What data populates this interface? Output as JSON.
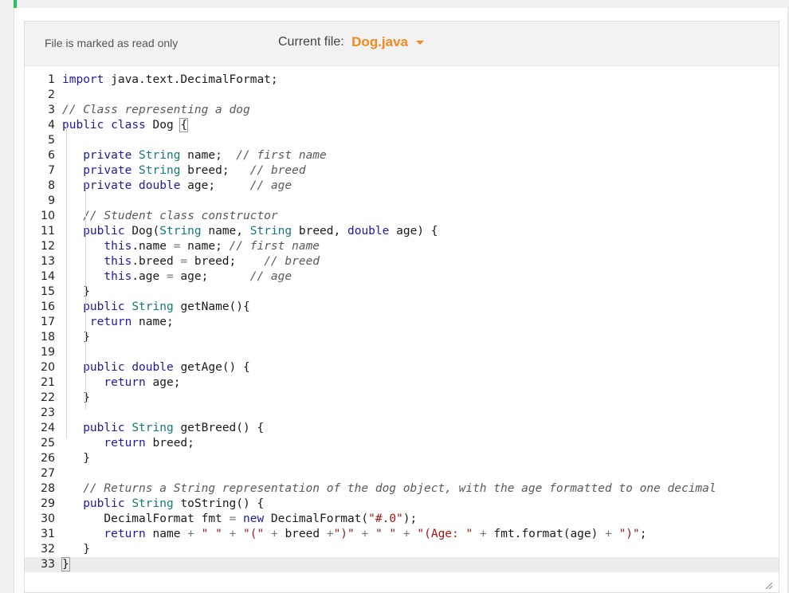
{
  "header": {
    "readonly_text": "File is marked as read only",
    "current_file_label": "Current file:",
    "current_file_name": "Dog.java"
  },
  "editor": {
    "lines": [
      {
        "n": "1",
        "c": "import java.text.DecimalFormat;"
      },
      {
        "n": "2",
        "c": ""
      },
      {
        "n": "3",
        "c": "// Class representing a dog"
      },
      {
        "n": "4",
        "c": "public class Dog {"
      },
      {
        "n": "5",
        "c": ""
      },
      {
        "n": "6",
        "c": "   private String name;  // first name"
      },
      {
        "n": "7",
        "c": "   private String breed;   // breed"
      },
      {
        "n": "8",
        "c": "   private double age;     // age"
      },
      {
        "n": "9",
        "c": ""
      },
      {
        "n": "10",
        "c": "   // Student class constructor"
      },
      {
        "n": "11",
        "c": "   public Dog(String name, String breed, double age) {"
      },
      {
        "n": "12",
        "c": "      this.name = name; // first name"
      },
      {
        "n": "13",
        "c": "      this.breed = breed;    // breed"
      },
      {
        "n": "14",
        "c": "      this.age = age;      // age"
      },
      {
        "n": "15",
        "c": "   }"
      },
      {
        "n": "16",
        "c": "   public String getName(){"
      },
      {
        "n": "17",
        "c": "    return name;"
      },
      {
        "n": "18",
        "c": "   }"
      },
      {
        "n": "19",
        "c": ""
      },
      {
        "n": "20",
        "c": "   public double getAge() {"
      },
      {
        "n": "21",
        "c": "      return age;"
      },
      {
        "n": "22",
        "c": "   }"
      },
      {
        "n": "23",
        "c": ""
      },
      {
        "n": "24",
        "c": "   public String getBreed() {"
      },
      {
        "n": "25",
        "c": "      return breed;"
      },
      {
        "n": "26",
        "c": "   }"
      },
      {
        "n": "27",
        "c": ""
      },
      {
        "n": "28",
        "c": "   // Returns a String representation of the dog object, with the age formatted to one decimal"
      },
      {
        "n": "29",
        "c": "   public String toString() {"
      },
      {
        "n": "30",
        "c": "      DecimalFormat fmt = new DecimalFormat(\"#.0\");"
      },
      {
        "n": "31",
        "c": "      return name + \" \" + \"(\" + breed +\")\" + \" \" + \"(Age: \" + fmt.format(age) + \")\";"
      },
      {
        "n": "32",
        "c": "   }"
      },
      {
        "n": "33",
        "c": "}"
      }
    ]
  },
  "colors": {
    "accent_orange": "#f08a1c",
    "keyword": "#1a1aa6",
    "type": "#117a7a",
    "comment": "#5a5a5a",
    "string": "#a31515",
    "status_green": "#22c55e"
  }
}
